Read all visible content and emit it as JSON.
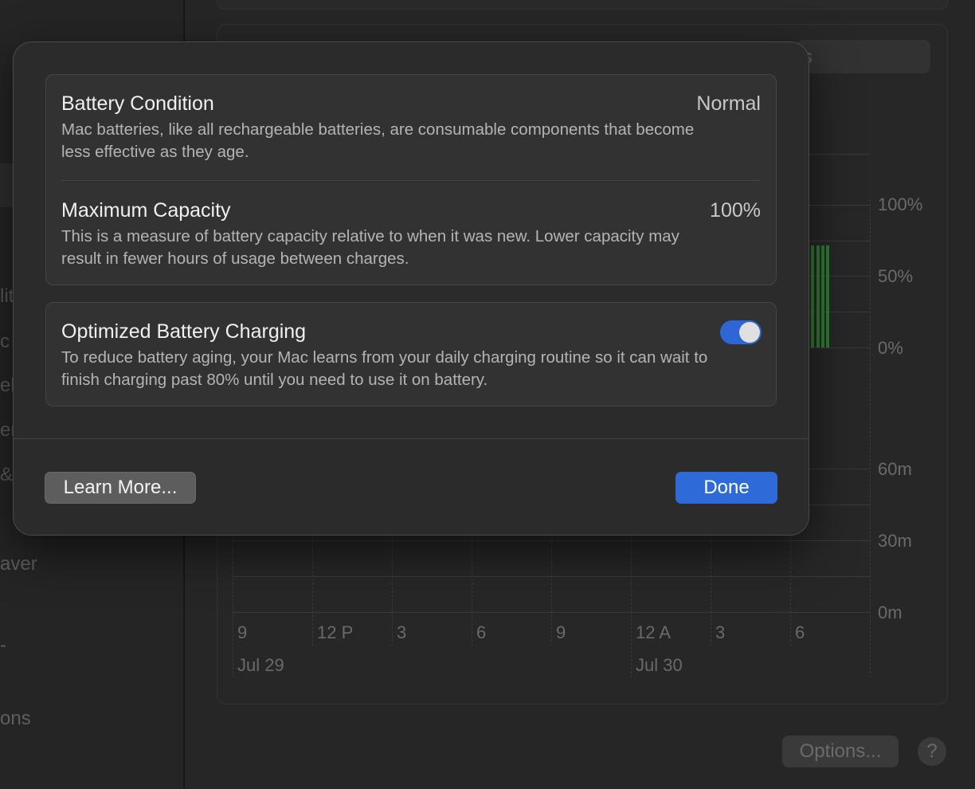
{
  "background": {
    "sidebar_fragments": [
      "lit",
      "c",
      "ell",
      "er",
      "&",
      "aver",
      "-",
      "ons"
    ],
    "segmented_fragment": "s",
    "chart": {
      "y_top_labels": [
        "100%",
        "50%",
        "0%"
      ],
      "y_bottom_labels": [
        "60m",
        "30m",
        "0m"
      ],
      "x_labels": [
        "9",
        "12 P",
        "3",
        "6",
        "9",
        "12 A",
        "3",
        "6"
      ],
      "x_dates": [
        "Jul 29",
        "Jul 30"
      ]
    },
    "options_label": "Options...",
    "help_label": "?"
  },
  "sheet": {
    "battery_condition": {
      "title": "Battery Condition",
      "value": "Normal",
      "description": "Mac batteries, like all rechargeable batteries, are consumable components that become less effective as they age."
    },
    "maximum_capacity": {
      "title": "Maximum Capacity",
      "value": "100%",
      "description": "This is a measure of battery capacity relative to when it was new. Lower capacity may result in fewer hours of usage between charges."
    },
    "optimized_charging": {
      "title": "Optimized Battery Charging",
      "enabled": true,
      "description": "To reduce battery aging, your Mac learns from your daily charging routine so it can wait to finish charging past 80% until you need to use it on battery."
    },
    "learn_more_label": "Learn More...",
    "done_label": "Done"
  },
  "colors": {
    "accent": "#2e6ad8",
    "toggle_on": "#2e66d6",
    "battery_bar": "#2e7d32"
  }
}
